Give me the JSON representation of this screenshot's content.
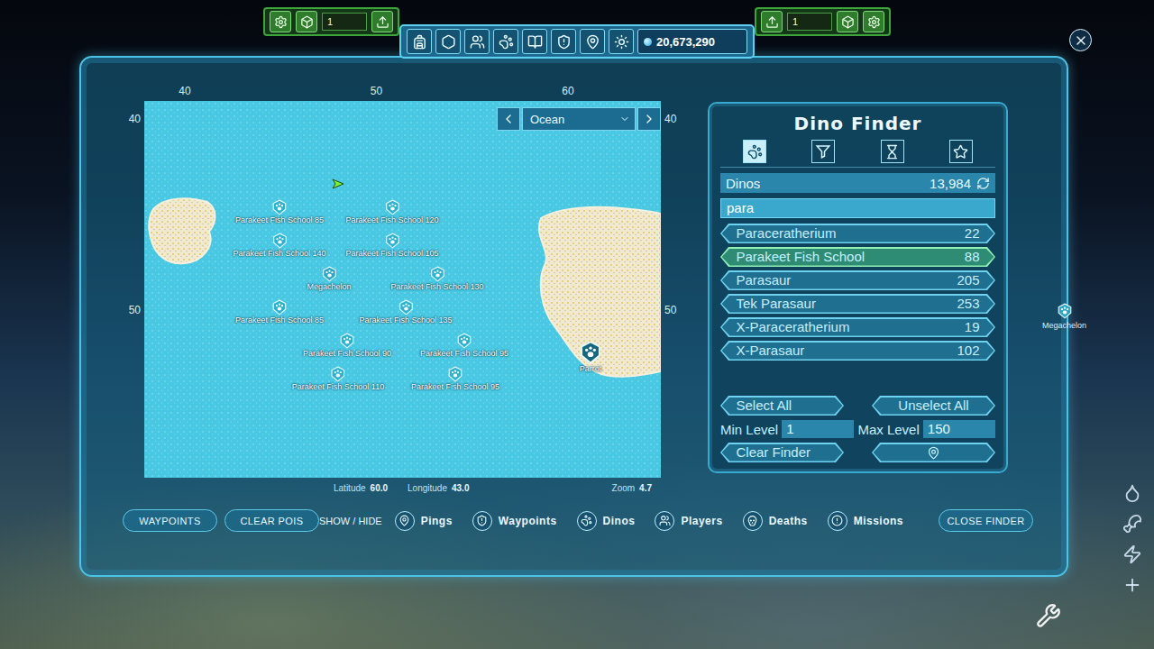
{
  "hud": {
    "left_field": "1",
    "right_field": "1",
    "currency": "20,673,290"
  },
  "map": {
    "region": "Ocean",
    "top_ticks": [
      "40",
      "50",
      "60"
    ],
    "left_ticks": [
      "40",
      "50"
    ],
    "right_ticks": [
      "40",
      "50"
    ],
    "pins": [
      {
        "label": "Parakeet Fish School 85",
        "kind": "school"
      },
      {
        "label": "Parakeet Fish School 120",
        "kind": "school"
      },
      {
        "label": "Parakeet Fish School 140",
        "kind": "school"
      },
      {
        "label": "Parakeet Fish School 105",
        "kind": "school"
      },
      {
        "label": "Megachelon",
        "kind": "creature"
      },
      {
        "label": "Parakeet Fish School 130",
        "kind": "school"
      },
      {
        "label": "Parakeet Fish School 85",
        "kind": "school"
      },
      {
        "label": "Parakeet Fish School 135",
        "kind": "school"
      },
      {
        "label": "Parakeet Fish School 90",
        "kind": "school"
      },
      {
        "label": "Parakeet Fish School 95",
        "kind": "school"
      },
      {
        "label": "Parakeet Fish School 110",
        "kind": "school"
      },
      {
        "label": "Parakeet Fish School 95",
        "kind": "school"
      },
      {
        "label": "Parrot",
        "kind": "target"
      }
    ],
    "latitude_label": "Latitude",
    "latitude": "60.0",
    "longitude_label": "Longitude",
    "longitude": "43.0",
    "zoom_label": "Zoom",
    "zoom": "4.7"
  },
  "finder": {
    "title": "Dino Finder",
    "tabs": [
      {
        "selected": true
      },
      {
        "selected": false
      },
      {
        "selected": false
      },
      {
        "selected": false
      }
    ],
    "count_label": "Dinos",
    "count": "13,984",
    "search": "para",
    "results": [
      {
        "name": "Paraceratherium",
        "count": "22",
        "selected": false
      },
      {
        "name": "Parakeet Fish School",
        "count": "88",
        "selected": true
      },
      {
        "name": "Parasaur",
        "count": "205",
        "selected": false
      },
      {
        "name": "Tek Parasaur",
        "count": "253",
        "selected": false
      },
      {
        "name": "X-Paraceratherium",
        "count": "19",
        "selected": false
      },
      {
        "name": "X-Parasaur",
        "count": "102",
        "selected": false
      }
    ],
    "select_all": "Select All",
    "unselect_all": "Unselect All",
    "min_level_label": "Min Level",
    "min_level": "1",
    "max_level_label": "Max Level",
    "max_level": "150",
    "clear": "Clear Finder"
  },
  "bottom_bar": {
    "waypoints": "WAYPOINTS",
    "clear_pois": "CLEAR POIS",
    "show_hide": "SHOW / HIDE",
    "toggles": [
      "Pings",
      "Waypoints",
      "Dinos",
      "Players",
      "Deaths",
      "Missions"
    ],
    "close": "CLOSE FINDER"
  },
  "tracker": {
    "label": "Megachelon"
  }
}
